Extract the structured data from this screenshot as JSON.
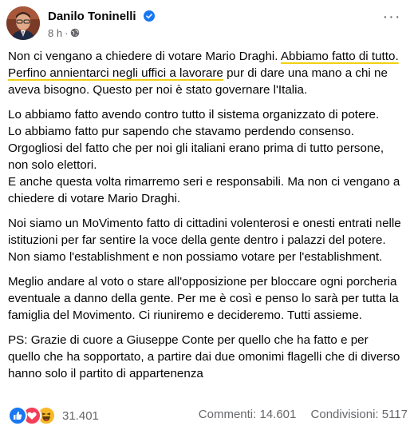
{
  "post": {
    "author": "Danilo Toninelli",
    "timestamp": "8 h",
    "separator": "·",
    "privacy_icon": "globe-icon",
    "more_icon": "more-horizontal-icon",
    "more_label": "···"
  },
  "content": {
    "p1_a": "Non ci vengano a chiedere di votare Mario Draghi. ",
    "p1_b": "Abbiamo fatto di tutto. Perfino annientarci negli uffici a lavorare",
    "p1_c": " pur di dare una mano a chi ne aveva bisogno. Questo per noi è stato governare l'Italia.",
    "p2_l1": "Lo abbiamo fatto avendo contro tutto il sistema organizzato di potere.",
    "p2_l2": "Lo abbiamo fatto pur sapendo che stavamo perdendo consenso.",
    "p2_l3": "Orgogliosi del fatto che per noi gli italiani erano prima di tutto persone, non solo elettori.",
    "p2_l4": "E anche questa volta rimarremo seri e responsabili. Ma non ci vengano a chiedere di votare Mario Draghi.",
    "p3": "Noi siamo un MoVimento fatto di cittadini volenterosi e onesti entrati nelle istituzioni per far sentire la voce della gente dentro i palazzi del potere. Non siamo l'establishment e non possiamo votare per l'establishment.",
    "p4": "Meglio andare al voto o stare all'opposizione per bloccare ogni porcheria eventuale a danno della gente. Per me è così e penso lo sarà per tutta la famiglia del Movimento. Ci riuniremo e decideremo. Tutti assieme.",
    "p5": "PS: Grazie di cuore a Giuseppe Conte per quello che ha fatto e per quello che ha sopportato, a partire dai due omonimi flagelli che di diverso hanno solo il partito di appartenenza"
  },
  "footer": {
    "reactions": [
      "like-icon",
      "love-icon",
      "haha-icon"
    ],
    "reaction_count": "31.401",
    "comments": "Commenti: 14.601",
    "shares": "Condivisioni: 5117"
  },
  "colors": {
    "like": "#1877f2",
    "love": "#f33e58",
    "haha": "#f7b928",
    "verified": "#1877f2",
    "highlight": "#f2d10f",
    "muted": "#65676b"
  }
}
